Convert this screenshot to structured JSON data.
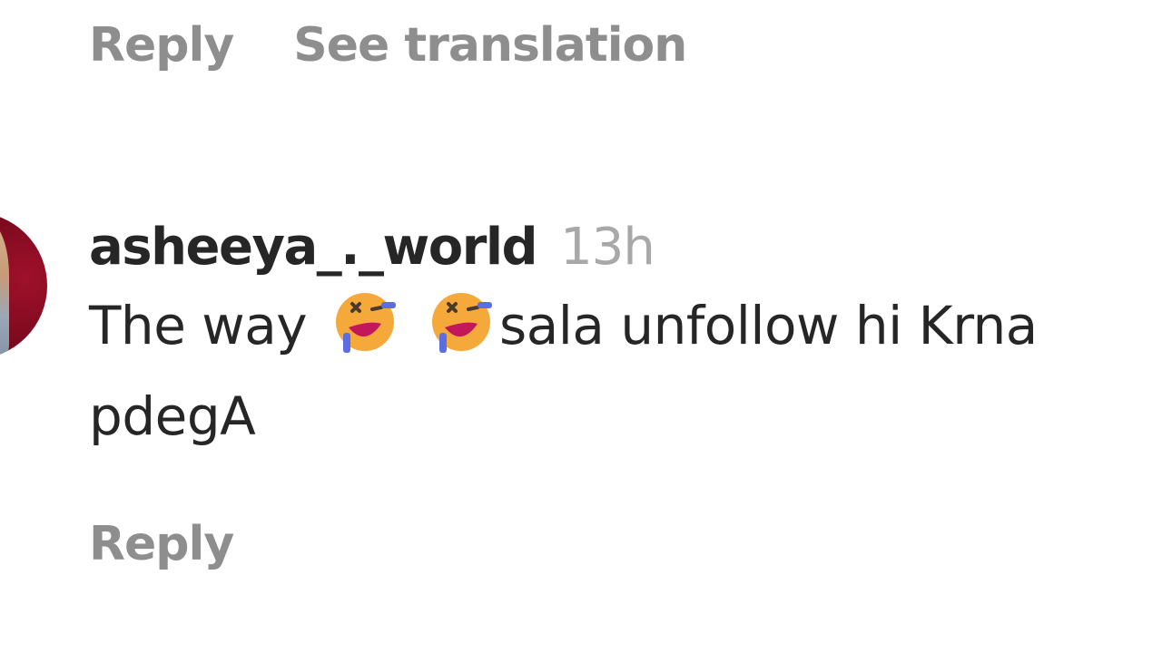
{
  "top_actions": {
    "reply_label": "Reply",
    "see_translation_label": "See translation"
  },
  "comment": {
    "username": "asheeya_._world",
    "timestamp": "13h",
    "text_part1": "The way",
    "emoji_1": "rolling-on-the-floor-laughing-emoji",
    "emoji_2": "rolling-on-the-floor-laughing-emoji",
    "text_part2": "sala unfollow hi Krna",
    "text_line2": "pdegA",
    "reply_label": "Reply"
  }
}
